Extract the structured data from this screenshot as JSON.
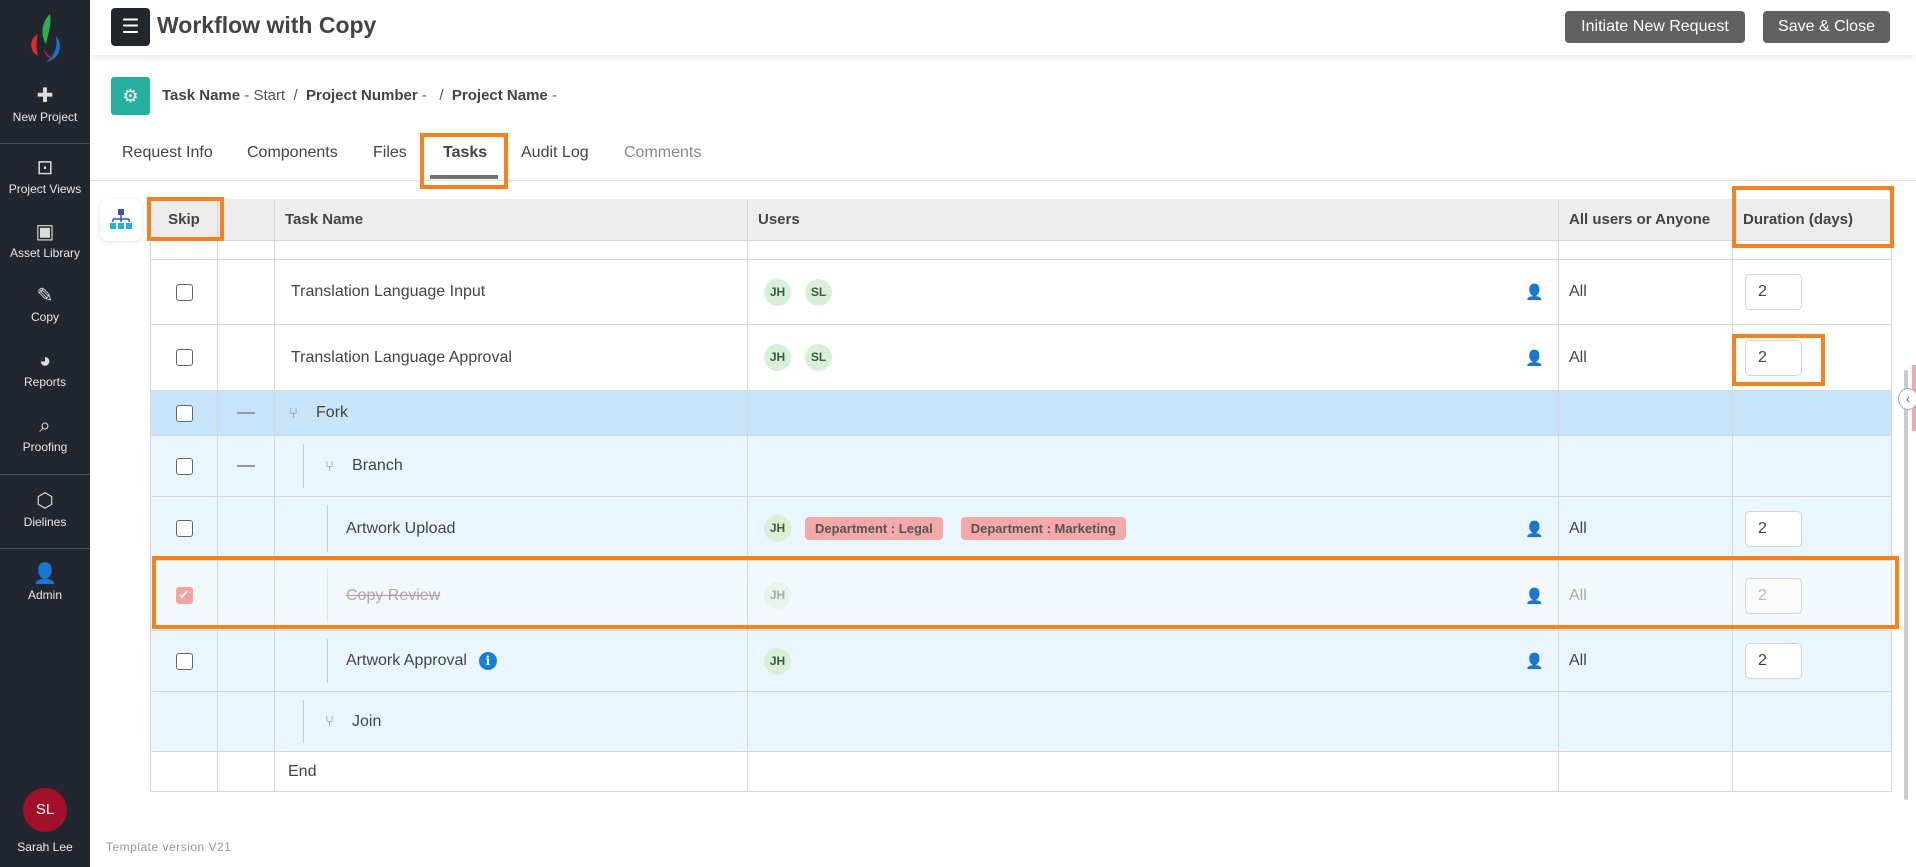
{
  "sidebar": {
    "items": [
      {
        "label": "New Project",
        "icon": "plus-icon"
      },
      {
        "label": "Project Views",
        "icon": "archive-icon"
      },
      {
        "label": "Asset Library",
        "icon": "image-icon"
      },
      {
        "label": "Copy",
        "icon": "edit-document-icon"
      },
      {
        "label": "Reports",
        "icon": "pie-chart-icon"
      },
      {
        "label": "Proofing",
        "icon": "proof-search-icon"
      },
      {
        "label": "Dielines",
        "icon": "cube-icon"
      },
      {
        "label": "Admin",
        "icon": "user-shield-icon"
      }
    ],
    "user": {
      "initials": "SL",
      "name": "Sarah Lee"
    }
  },
  "header": {
    "title": "Workflow with Copy",
    "initiate_label": "Initiate New Request",
    "save_close_label": "Save & Close"
  },
  "breadcrumb": {
    "task_label": "Task Name",
    "task_value": "- Start",
    "sep": "/",
    "project_number_label": "Project Number",
    "project_number_value": "-",
    "project_name_label": "Project Name",
    "project_name_value": "-"
  },
  "tabs": [
    "Request Info",
    "Components",
    "Files",
    "Tasks",
    "Audit Log",
    "Comments"
  ],
  "active_tab": "Tasks",
  "table": {
    "headers": {
      "skip": "Skip",
      "task": "Task Name",
      "users": "Users",
      "mode": "All users or Anyone",
      "duration": "Duration (days)"
    },
    "rows": [
      {
        "name": "Translation Language Input",
        "users": [
          "JH",
          "SL"
        ],
        "mode": "All",
        "duration": "2",
        "skipped": false
      },
      {
        "name": "Translation Language Approval",
        "users": [
          "JH",
          "SL"
        ],
        "mode": "All",
        "duration": "2",
        "skipped": false
      },
      {
        "name": "Fork"
      },
      {
        "name": "Branch"
      },
      {
        "name": "Artwork Upload",
        "users": [
          "JH"
        ],
        "tags": [
          "Department : Legal",
          "Department : Marketing"
        ],
        "mode": "All",
        "duration": "2",
        "skipped": false
      },
      {
        "name": "Copy Review",
        "users": [
          "JH"
        ],
        "mode": "All",
        "duration": "2",
        "skipped": true
      },
      {
        "name": "Artwork Approval",
        "users": [
          "JH"
        ],
        "mode": "All",
        "duration": "2",
        "skipped": false,
        "info": "i"
      },
      {
        "name": "Join"
      },
      {
        "name": "End"
      }
    ]
  },
  "footer": {
    "version": "Template version V21"
  },
  "colors": {
    "highlight": "#f6821f",
    "sidebar": "#22262e",
    "fork_row": "#c8e4fb",
    "branch_rows": "#eaf6fd"
  }
}
